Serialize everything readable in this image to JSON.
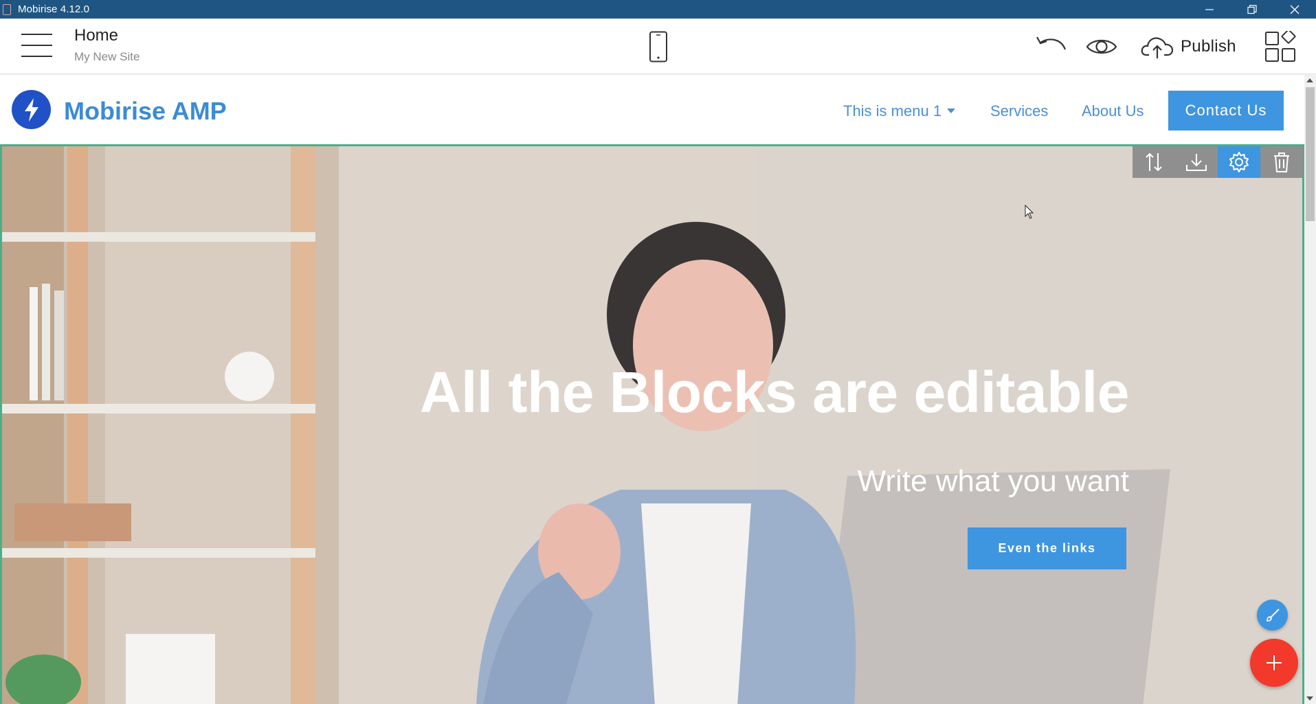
{
  "window": {
    "title": "Mobirise 4.12.0",
    "controls": [
      "minimize-icon",
      "restore-icon",
      "close-icon"
    ]
  },
  "editor_toolbar": {
    "page_title": "Home",
    "site_name": "My New Site",
    "publish_label": "Publish",
    "icons": [
      "menu-icon",
      "mobile-preview-icon",
      "undo-icon",
      "preview-eye-icon",
      "cloud-upload-icon",
      "blocks-icon"
    ]
  },
  "site": {
    "brand_name": "Mobirise AMP",
    "nav": {
      "menu1": "This is menu 1",
      "services": "Services",
      "about": "About Us",
      "contact": "Contact Us"
    },
    "hero": {
      "title": "All the Blocks are editable",
      "subtitle": "Write what you want",
      "button": "Even the links"
    }
  },
  "block_tools": [
    "move-icon",
    "download-icon",
    "settings-icon",
    "trash-icon"
  ],
  "colors": {
    "titlebar": "#1f5582",
    "accent": "#3e95e0",
    "brand": "#3b8bd6",
    "logo": "#2151c7",
    "add_button": "#f2392b",
    "block_outline": "#4bae8a"
  }
}
